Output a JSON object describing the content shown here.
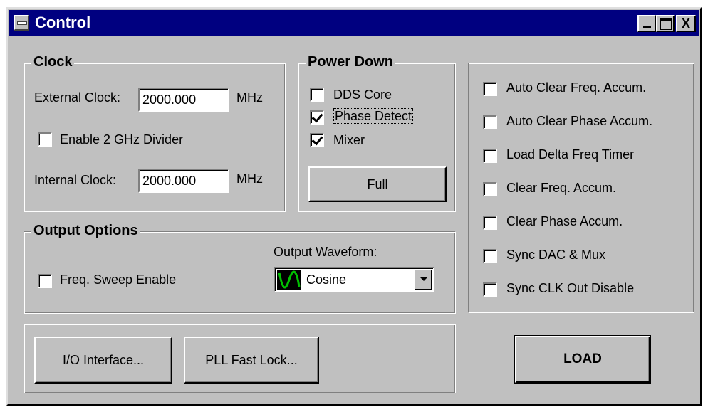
{
  "window": {
    "title": "Control",
    "close_glyph": "X"
  },
  "clock": {
    "legend": "Clock",
    "external_label": "External Clock:",
    "external_value": "2000.000",
    "external_unit": "MHz",
    "divider_label": "Enable 2 GHz Divider",
    "divider_checked": false,
    "internal_label": "Internal Clock:",
    "internal_value": "2000.000",
    "internal_unit": "MHz"
  },
  "power_down": {
    "legend": "Power Down",
    "items": [
      {
        "label": "DDS Core",
        "checked": false
      },
      {
        "label": "Phase Detect",
        "checked": true
      },
      {
        "label": "Mixer",
        "checked": true
      }
    ],
    "full_button": "Full"
  },
  "right_options": {
    "items": [
      {
        "label": "Auto Clear Freq. Accum.",
        "checked": false
      },
      {
        "label": "Auto Clear Phase Accum.",
        "checked": false
      },
      {
        "label": "Load Delta Freq Timer",
        "checked": false
      },
      {
        "label": "Clear Freq. Accum.",
        "checked": false
      },
      {
        "label": "Clear Phase Accum.",
        "checked": false
      },
      {
        "label": "Sync DAC & Mux",
        "checked": false
      },
      {
        "label": "Sync CLK Out Disable",
        "checked": false
      }
    ]
  },
  "output_options": {
    "legend": "Output Options",
    "sweep_label": "Freq. Sweep Enable",
    "sweep_checked": false,
    "waveform_label": "Output Waveform:",
    "waveform_value": "Cosine",
    "waveform_icon": "cosine-wave-icon"
  },
  "buttons": {
    "io_interface": "I/O Interface...",
    "pll_fast_lock": "PLL Fast Lock...",
    "load": "LOAD"
  },
  "colors": {
    "titlebar": "#000080",
    "face": "#c0c0c0",
    "wave_trace": "#00c000"
  }
}
